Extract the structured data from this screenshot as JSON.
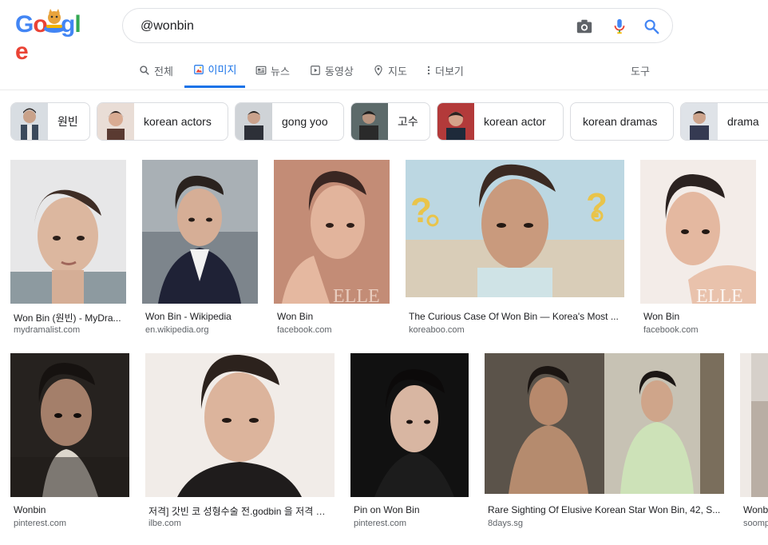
{
  "logo": {
    "text": "Google"
  },
  "search": {
    "query": "@wonbin"
  },
  "tabs": [
    {
      "label": "전체"
    },
    {
      "label": "이미지"
    },
    {
      "label": "뉴스"
    },
    {
      "label": "동영상"
    },
    {
      "label": "지도"
    },
    {
      "label": "더보기"
    }
  ],
  "tools_label": "도구",
  "chips": [
    {
      "label": "원빈"
    },
    {
      "label": "korean actors"
    },
    {
      "label": "gong yoo"
    },
    {
      "label": "고수"
    },
    {
      "label": "korean actor"
    },
    {
      "label": "korean dramas"
    },
    {
      "label": "drama"
    }
  ],
  "results": [
    {
      "title": "Won Bin (원빈) - MyDra...",
      "source": "mydramalist.com"
    },
    {
      "title": "Won Bin - Wikipedia",
      "source": "en.wikipedia.org"
    },
    {
      "title": "Won Bin",
      "source": "facebook.com"
    },
    {
      "title": "The Curious Case Of Won Bin — Korea's Most ...",
      "source": "koreaboo.com"
    },
    {
      "title": "Won Bin",
      "source": "facebook.com"
    },
    {
      "title": "Wonbin",
      "source": "pinterest.com"
    },
    {
      "title": "저격] 갓빈 코 성형수술 전.godbin 을 저격 한...",
      "source": "ilbe.com"
    },
    {
      "title": "Pin on Won Bin",
      "source": "pinterest.com"
    },
    {
      "title": "Rare Sighting Of Elusive Korean Star Won Bin, 42, S...",
      "source": "8days.sg"
    },
    {
      "title": "Wonb",
      "source": "soomp"
    }
  ]
}
